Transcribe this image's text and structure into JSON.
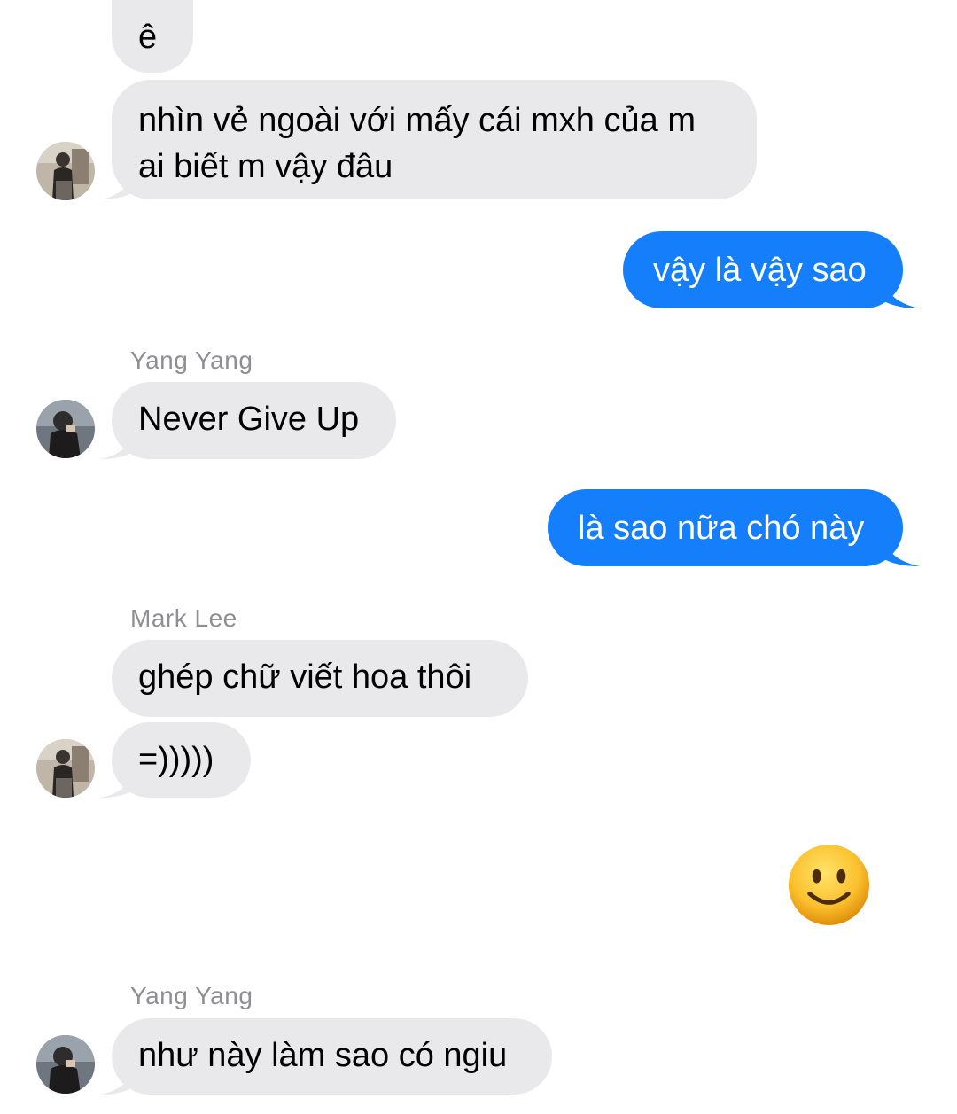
{
  "conversation": {
    "messages": [
      {
        "text": "ê"
      },
      {
        "text": "nhìn vẻ ngoài với mấy cái mxh của m ai biết m vậy đâu"
      },
      {
        "text": "vậy là vậy sao"
      },
      {
        "text": "Never Give Up"
      },
      {
        "text": "là sao nữa chó này"
      },
      {
        "text": "ghép chữ viết hoa thôi"
      },
      {
        "text": "=)))))"
      },
      {
        "text": "như này làm sao có ngiu"
      }
    ],
    "senders": {
      "yang_yang_1": "Yang Yang",
      "mark_lee": "Mark Lee",
      "yang_yang_2": "Yang Yang"
    },
    "emoji_reply": "slightly-smiling-face-icon"
  },
  "colors": {
    "incoming_bubble": "#e9e9eb",
    "outgoing_bubble": "#147efb",
    "sender_name": "#8e8e93"
  }
}
